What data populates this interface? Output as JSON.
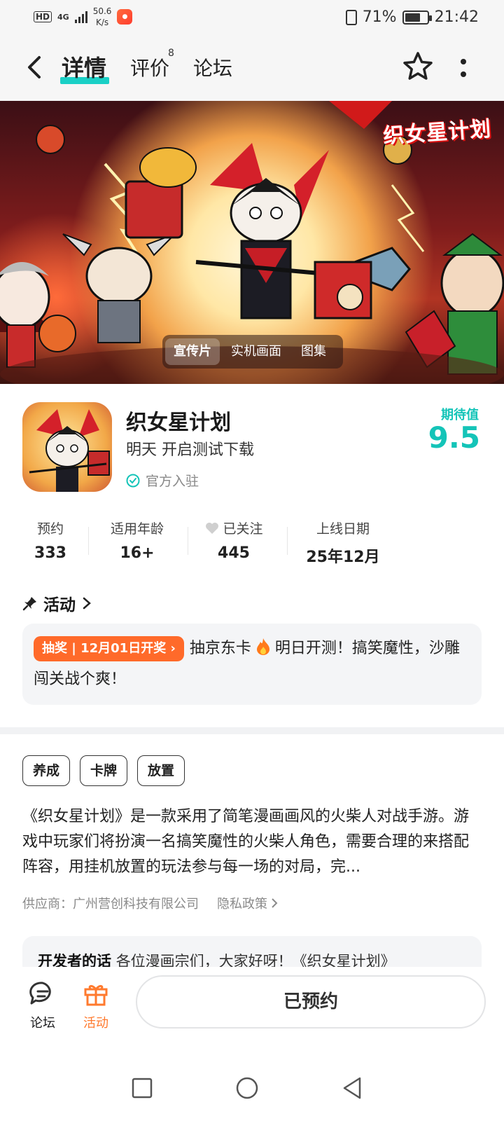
{
  "status_bar": {
    "network_type": "HD",
    "signal": "4G",
    "speed": "50.6",
    "speed_unit": "K/s",
    "battery": "71%",
    "time": "21:42"
  },
  "nav": {
    "tabs": [
      {
        "label": "详情",
        "active": true
      },
      {
        "label": "评价",
        "badge": "8"
      },
      {
        "label": "论坛"
      }
    ],
    "icons": [
      "back-icon",
      "star-icon",
      "more-icon"
    ]
  },
  "banner": {
    "logo_text": "织女星计划",
    "media_tabs": [
      {
        "label": "宣传片",
        "active": true
      },
      {
        "label": "实机画面"
      },
      {
        "label": "图集"
      }
    ]
  },
  "app": {
    "name": "织女星计划",
    "subtitle": "明天 开启测试下载",
    "official": "官方入驻",
    "expect_label": "期待值",
    "expect_value": "9.5"
  },
  "stats": [
    {
      "label": "预约",
      "value": "333"
    },
    {
      "label": "适用年龄",
      "value": "16+"
    },
    {
      "label": "已关注",
      "value": "445"
    },
    {
      "label": "上线日期",
      "value": "25年12月"
    }
  ],
  "activity": {
    "heading": "活动",
    "badge": "抽奖 | 12月01日开奖",
    "text_before": "抽京东卡",
    "text_after": "明日开测！搞笑魔性，沙雕闯关战个爽！"
  },
  "tags": [
    "养成",
    "卡牌",
    "放置"
  ],
  "description": "《织女星计划》是一款采用了简笔漫画画风的火柴人对战手游。游戏中玩家们将扮演一名搞笑魔性的火柴人角色，需要合理的来搭配阵容，用挂机放置的玩法参与每一场的对局，完...",
  "supplier": {
    "label": "供应商：广州营创科技有限公司",
    "privacy": "隐私政策"
  },
  "developer_note": {
    "title": "开发者的话",
    "text": "各位漫画宗们，大家好呀！《织女星计划》"
  },
  "bottom_bar": {
    "forum_label": "论坛",
    "activity_label": "活动",
    "reserve_label": "已预约",
    "accent_color": "#ff7a2e"
  },
  "colors": {
    "teal": "#14c4b8",
    "orange": "#ff6a2a"
  }
}
